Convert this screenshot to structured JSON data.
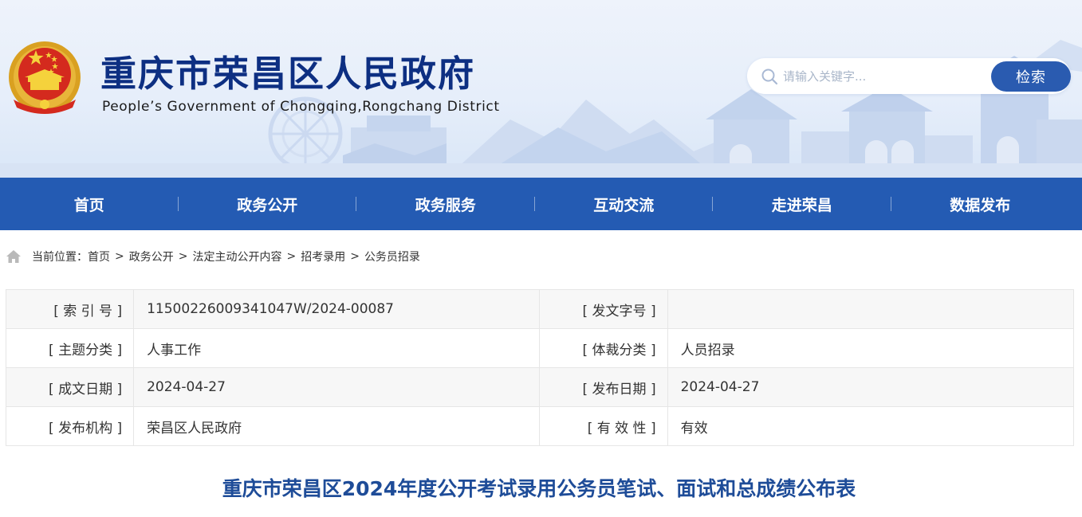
{
  "header": {
    "title": "重庆市荣昌区人民政府",
    "subtitle": "People’s Government of Chongqing,Rongchang District",
    "emblem_icon": "national-emblem-icon",
    "brand_color": "#0d2f82"
  },
  "search": {
    "placeholder": "请输入关键字...",
    "button_label": "检索",
    "icon": "search-icon"
  },
  "nav": {
    "items": [
      {
        "label": "首页"
      },
      {
        "label": "政务公开"
      },
      {
        "label": "政务服务"
      },
      {
        "label": "互动交流"
      },
      {
        "label": "走进荣昌"
      },
      {
        "label": "数据发布"
      }
    ],
    "background": "#245bb3"
  },
  "breadcrumb": {
    "prefix": "当前位置：",
    "items": [
      "首页",
      "政务公开",
      "法定主动公开内容",
      "招考录用",
      "公务员招录"
    ],
    "separator": ">"
  },
  "info": {
    "rows": [
      {
        "label1": "[ 索 引 号 ]",
        "value1": "11500226009341047W/2024-00087",
        "label2": "[ 发文字号 ]",
        "value2": ""
      },
      {
        "label1": "[ 主题分类 ]",
        "value1": "人事工作",
        "label2": "[ 体裁分类 ]",
        "value2": "人员招录"
      },
      {
        "label1": "[ 成文日期 ]",
        "value1": "2024-04-27",
        "label2": "[ 发布日期 ]",
        "value2": "2024-04-27"
      },
      {
        "label1": "[ 发布机构 ]",
        "value1": "荣昌区人民政府",
        "label2": "[ 有 效 性 ]",
        "value2": "有效"
      }
    ]
  },
  "article": {
    "title": "重庆市荣昌区2024年度公开考试录用公务员笔试、面试和总成绩公布表"
  }
}
